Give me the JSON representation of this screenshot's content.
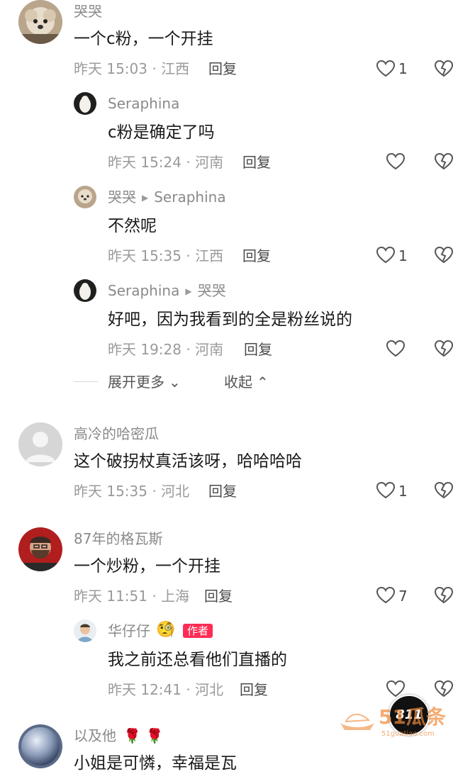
{
  "comments": [
    {
      "user": "哭哭",
      "text": "一个c粉，一个开挂",
      "meta": "昨天 15:03 · 江西",
      "reply": "回复",
      "likes": "1",
      "avatar": "dog-avatar",
      "replies": [
        {
          "user": "Seraphina",
          "to": "",
          "text": "c粉是确定了吗",
          "meta": "昨天 15:24 · 河南",
          "reply": "回复",
          "likes": "",
          "avatar": "seraphina-avatar"
        },
        {
          "user": "哭哭",
          "to": "Seraphina",
          "text": "不然呢",
          "meta": "昨天 15:35 · 江西",
          "reply": "回复",
          "likes": "1",
          "avatar": "dog-avatar"
        },
        {
          "user": "Seraphina",
          "to": "哭哭",
          "text": "好吧，因为我看到的全是粉丝说的",
          "meta": "昨天 19:28 · 河南",
          "reply": "回复",
          "likes": "",
          "avatar": "seraphina-avatar"
        }
      ],
      "expand_more": "展开更多",
      "collapse": "收起"
    },
    {
      "user": "高冷的哈密瓜",
      "text": "这个破拐杖真活该呀，哈哈哈哈",
      "meta": "昨天 15:35 · 河北",
      "reply": "回复",
      "likes": "1",
      "avatar": "default-avatar"
    },
    {
      "user": "87年的格瓦斯",
      "text": "一个炒粉，一个开挂",
      "meta": "昨天 11:51 · 上海",
      "reply": "回复",
      "likes": "7",
      "avatar": "man-avatar",
      "replies": [
        {
          "user": "华仔仔",
          "badge": "作者",
          "text": "我之前还总看他们直播的",
          "meta": "昨天 12:41 · 河北",
          "reply": "回复",
          "likes": "",
          "avatar": "boy-avatar"
        }
      ]
    },
    {
      "user": "以及他",
      "emoji": "🌹 🌹",
      "text": "小姐是可憐，幸福是瓦",
      "avatar": "sphere-avatar"
    }
  ],
  "overlay": {
    "bubble": "811",
    "watermark_text": "51瓜条",
    "watermark_url": "51guatiao.com"
  },
  "colors": {
    "username": "#8a8a8a",
    "meta": "#9a9a9a",
    "badge": "#fe2c55",
    "watermark": "#f08a3a"
  }
}
